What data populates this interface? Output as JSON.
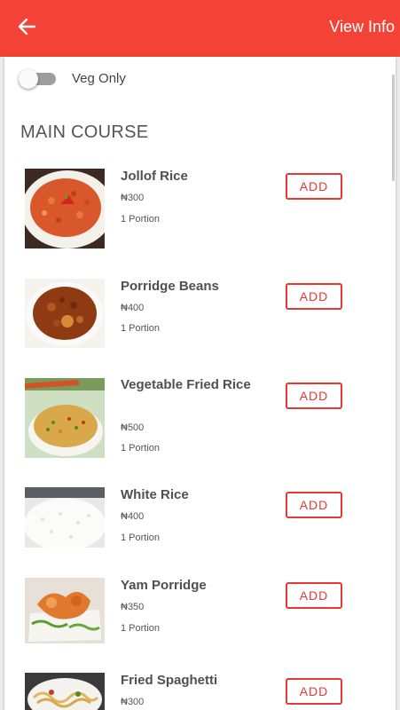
{
  "header": {
    "back_icon": "arrow-left-icon",
    "view_info_label": "View Info",
    "color": "#f44336"
  },
  "filter": {
    "veg_only_label": "Veg Only",
    "veg_only_enabled": false
  },
  "section": {
    "title": "MAIN COURSE"
  },
  "accent": "#e53935",
  "items": [
    {
      "name": "Jollof Rice",
      "price": "₦300",
      "portion": "1 Portion",
      "add_label": "ADD"
    },
    {
      "name": "Porridge Beans",
      "price": "₦400",
      "portion": "1 Portion",
      "add_label": "ADD"
    },
    {
      "name": "Vegetable Fried Rice",
      "price": "₦500",
      "portion": "1 Portion",
      "add_label": "ADD"
    },
    {
      "name": "White Rice",
      "price": "₦400",
      "portion": "1 Portion",
      "add_label": "ADD"
    },
    {
      "name": "Yam Porridge",
      "price": "₦350",
      "portion": "1 Portion",
      "add_label": "ADD"
    },
    {
      "name": "Fried Spaghetti",
      "price": "₦300",
      "add_label": "ADD"
    }
  ]
}
